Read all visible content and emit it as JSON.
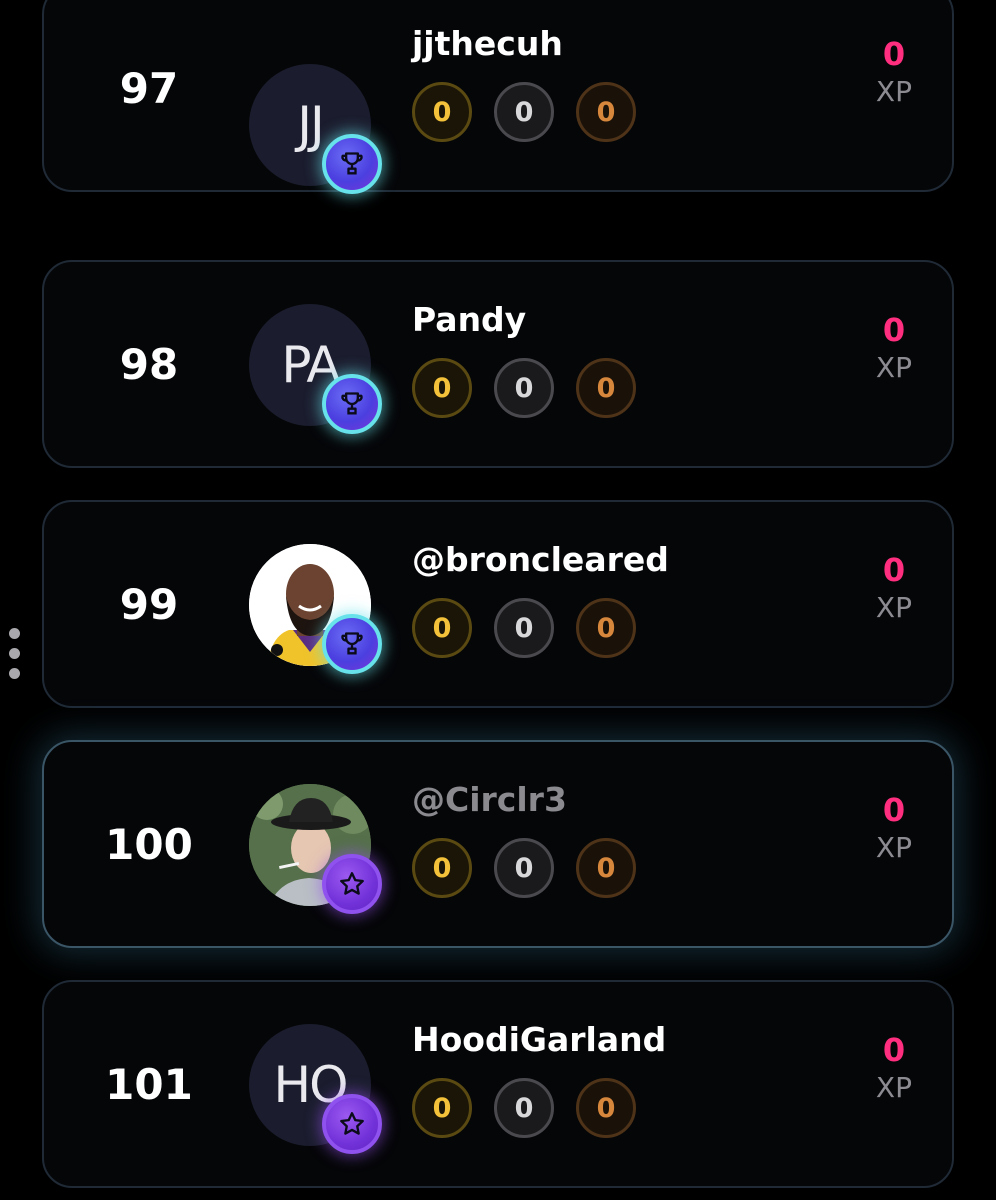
{
  "leaderboard": {
    "rows": [
      {
        "rank": "97",
        "username": "jjthecuh",
        "initials": "JJ",
        "badge": "trophy-icon",
        "medals": {
          "gold": "0",
          "silver": "0",
          "bronze": "0"
        },
        "xp_value": "0",
        "xp_label": "XP"
      },
      {
        "rank": "98",
        "username": "Pandy",
        "initials": "PA",
        "badge": "trophy-icon",
        "medals": {
          "gold": "0",
          "silver": "0",
          "bronze": "0"
        },
        "xp_value": "0",
        "xp_label": "XP"
      },
      {
        "rank": "99",
        "username": "@broncleared",
        "initials": "",
        "badge": "trophy-icon",
        "medals": {
          "gold": "0",
          "silver": "0",
          "bronze": "0"
        },
        "xp_value": "0",
        "xp_label": "XP"
      },
      {
        "rank": "100",
        "username": "@Circlr3",
        "initials": "",
        "badge": "star-icon",
        "medals": {
          "gold": "0",
          "silver": "0",
          "bronze": "0"
        },
        "xp_value": "0",
        "xp_label": "XP"
      },
      {
        "rank": "101",
        "username": "HoodiGarland",
        "initials": "HO",
        "badge": "star-icon",
        "medals": {
          "gold": "0",
          "silver": "0",
          "bronze": "0"
        },
        "xp_value": "0",
        "xp_label": "XP"
      }
    ]
  },
  "colors": {
    "xp_accent": "#ff2e7e",
    "gold": "#f3c13a",
    "silver": "#d8d8da",
    "bronze": "#d7873c",
    "trophy_badge_ring": "#67e1ea",
    "star_badge_ring": "#8f52ee"
  }
}
